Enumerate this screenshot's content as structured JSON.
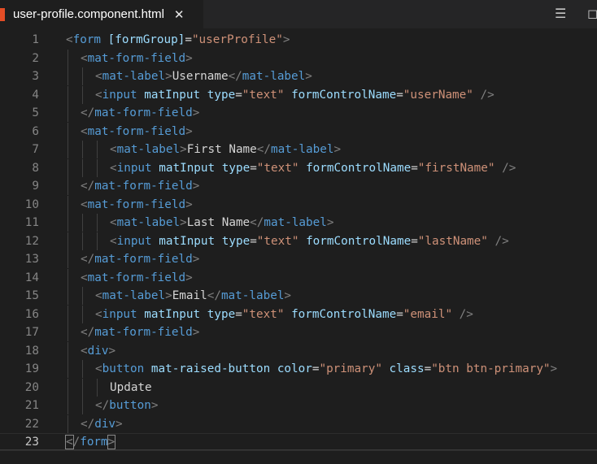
{
  "tab": {
    "title": "user-profile.component.html",
    "close_glyph": "✕",
    "icon": "html5-file-icon"
  },
  "actions": {
    "split_glyph": "☰",
    "more_glyph": "◻"
  },
  "editor": {
    "active_line": 23,
    "lines": [
      {
        "n": "1",
        "indent": 0,
        "html": "<span class='t'>&lt;</span><span class='tag'>form</span> <span class='attr'>[formGroup]</span><span class='txt'>=</span><span class='str'>\"userProfile\"</span><span class='t'>&gt;</span>"
      },
      {
        "n": "2",
        "indent": 1,
        "html": "<span class='t'>&lt;</span><span class='tag'>mat-form-field</span><span class='t'>&gt;</span>"
      },
      {
        "n": "3",
        "indent": 2,
        "html": "<span class='t'>&lt;</span><span class='tag'>mat-label</span><span class='t'>&gt;</span><span class='txt'>Username</span><span class='t'>&lt;/</span><span class='tag'>mat-label</span><span class='t'>&gt;</span>"
      },
      {
        "n": "4",
        "indent": 2,
        "html": "<span class='t'>&lt;</span><span class='tag'>input</span> <span class='attr'>matInput</span> <span class='attr'>type</span><span class='txt'>=</span><span class='str'>\"text\"</span> <span class='attr'>formControlName</span><span class='txt'>=</span><span class='str'>\"userName\"</span> <span class='t'>/&gt;</span>"
      },
      {
        "n": "5",
        "indent": 1,
        "html": "<span class='t'>&lt;/</span><span class='tag'>mat-form-field</span><span class='t'>&gt;</span>"
      },
      {
        "n": "6",
        "indent": 1,
        "html": "<span class='t'>&lt;</span><span class='tag'>mat-form-field</span><span class='t'>&gt;</span>"
      },
      {
        "n": "7",
        "indent": 3,
        "html": "<span class='t'>&lt;</span><span class='tag'>mat-label</span><span class='t'>&gt;</span><span class='txt'>First Name</span><span class='t'>&lt;/</span><span class='tag'>mat-label</span><span class='t'>&gt;</span>"
      },
      {
        "n": "8",
        "indent": 3,
        "html": "<span class='t'>&lt;</span><span class='tag'>input</span> <span class='attr'>matInput</span> <span class='attr'>type</span><span class='txt'>=</span><span class='str'>\"text\"</span> <span class='attr'>formControlName</span><span class='txt'>=</span><span class='str'>\"firstName\"</span> <span class='t'>/&gt;</span>"
      },
      {
        "n": "9",
        "indent": 1,
        "html": "<span class='t'>&lt;/</span><span class='tag'>mat-form-field</span><span class='t'>&gt;</span>"
      },
      {
        "n": "10",
        "indent": 1,
        "html": "<span class='t'>&lt;</span><span class='tag'>mat-form-field</span><span class='t'>&gt;</span>"
      },
      {
        "n": "11",
        "indent": 3,
        "html": "<span class='t'>&lt;</span><span class='tag'>mat-label</span><span class='t'>&gt;</span><span class='txt'>Last Name</span><span class='t'>&lt;/</span><span class='tag'>mat-label</span><span class='t'>&gt;</span>"
      },
      {
        "n": "12",
        "indent": 3,
        "html": "<span class='t'>&lt;</span><span class='tag'>input</span> <span class='attr'>matInput</span> <span class='attr'>type</span><span class='txt'>=</span><span class='str'>\"text\"</span> <span class='attr'>formControlName</span><span class='txt'>=</span><span class='str'>\"lastName\"</span> <span class='t'>/&gt;</span>"
      },
      {
        "n": "13",
        "indent": 1,
        "html": "<span class='t'>&lt;/</span><span class='tag'>mat-form-field</span><span class='t'>&gt;</span>"
      },
      {
        "n": "14",
        "indent": 1,
        "html": "<span class='t'>&lt;</span><span class='tag'>mat-form-field</span><span class='t'>&gt;</span>"
      },
      {
        "n": "15",
        "indent": 2,
        "html": "<span class='t'>&lt;</span><span class='tag'>mat-label</span><span class='t'>&gt;</span><span class='txt'>Email</span><span class='t'>&lt;/</span><span class='tag'>mat-label</span><span class='t'>&gt;</span>"
      },
      {
        "n": "16",
        "indent": 2,
        "html": "<span class='t'>&lt;</span><span class='tag'>input</span> <span class='attr'>matInput</span> <span class='attr'>type</span><span class='txt'>=</span><span class='str'>\"text\"</span> <span class='attr'>formControlName</span><span class='txt'>=</span><span class='str'>\"email\"</span> <span class='t'>/&gt;</span>"
      },
      {
        "n": "17",
        "indent": 1,
        "html": "<span class='t'>&lt;/</span><span class='tag'>mat-form-field</span><span class='t'>&gt;</span>"
      },
      {
        "n": "18",
        "indent": 1,
        "html": "<span class='t'>&lt;</span><span class='tag'>div</span><span class='t'>&gt;</span>"
      },
      {
        "n": "19",
        "indent": 2,
        "html": "<span class='t'>&lt;</span><span class='tag'>button</span> <span class='attr'>mat-raised-button</span> <span class='attr'>color</span><span class='txt'>=</span><span class='str'>\"primary\"</span> <span class='attr'>class</span><span class='txt'>=</span><span class='str'>\"btn btn-primary\"</span><span class='t'>&gt;</span>"
      },
      {
        "n": "20",
        "indent": 3,
        "html": "<span class='txt'>Update</span>"
      },
      {
        "n": "21",
        "indent": 2,
        "html": "<span class='t'>&lt;/</span><span class='tag'>button</span><span class='t'>&gt;</span>"
      },
      {
        "n": "22",
        "indent": 1,
        "html": "<span class='t'>&lt;/</span><span class='tag'>div</span><span class='t'>&gt;</span>"
      },
      {
        "n": "23",
        "indent": 0,
        "html": "<span class='t bm'>&lt;</span><span class='t'>/</span><span class='tag'>form</span><span class='t bm'>&gt;</span>"
      }
    ]
  }
}
